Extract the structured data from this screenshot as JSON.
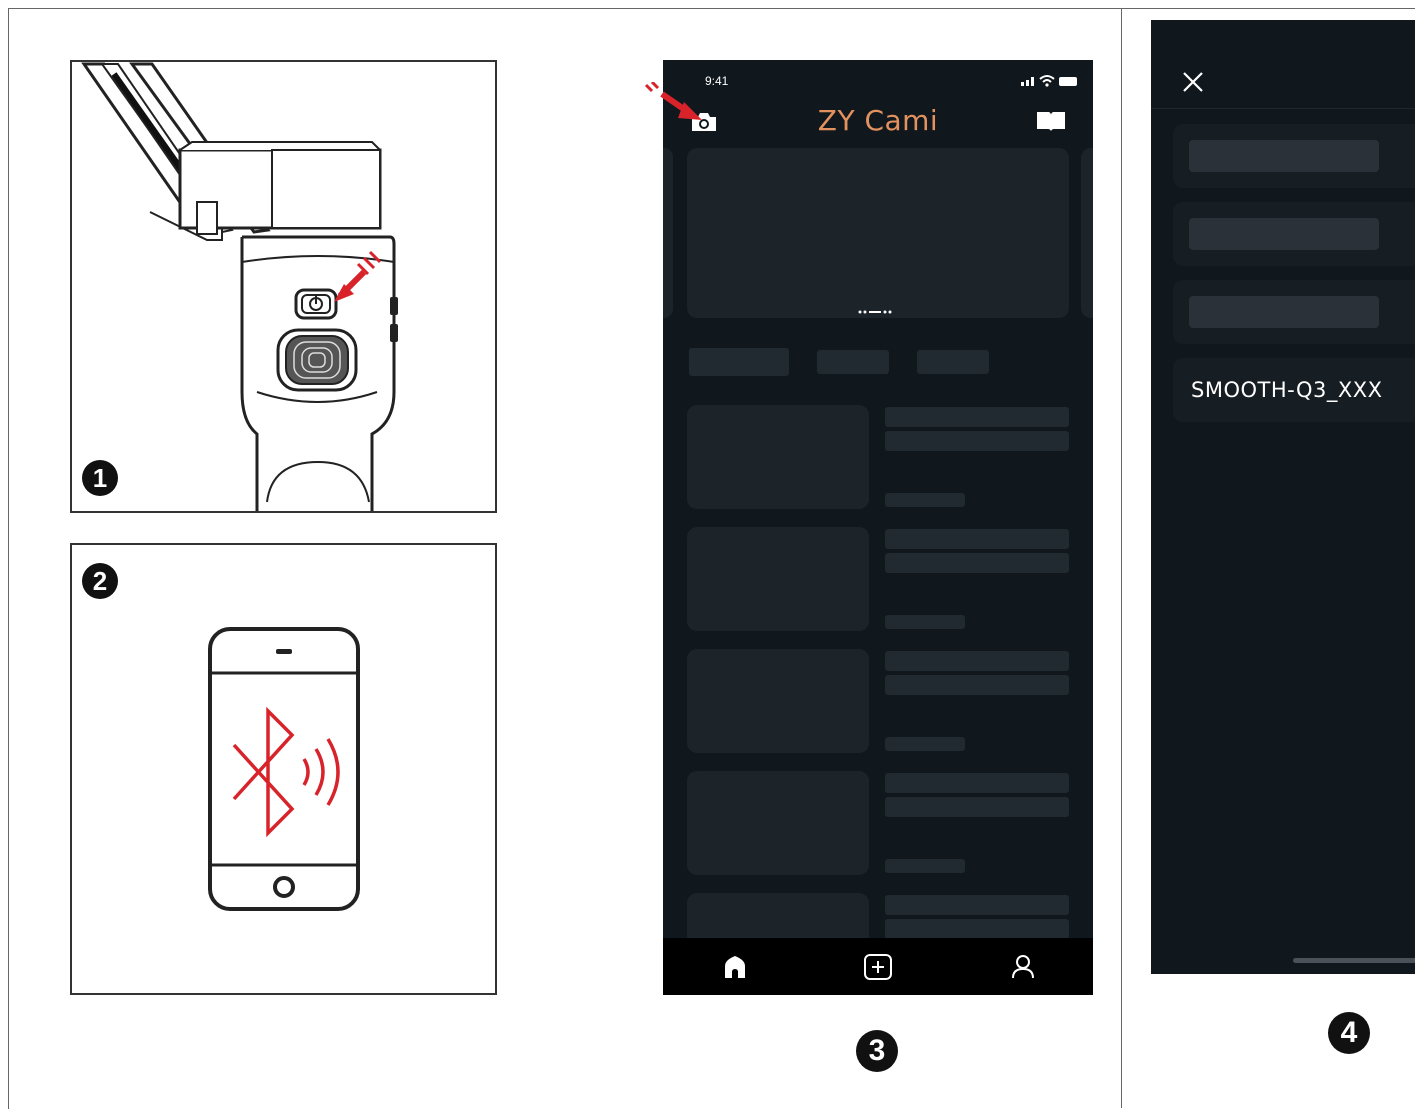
{
  "steps": {
    "step1": "1",
    "step2": "2",
    "step3": "3",
    "step4": "4"
  },
  "app_screen": {
    "status_time": "9:41",
    "title": "ZY Cami",
    "colors": {
      "title": "#e3925f",
      "background": "#10171d",
      "accent_arrow": "#d8232a"
    },
    "icons": [
      "camera-icon",
      "book-icon",
      "home-icon",
      "add-icon",
      "user-icon"
    ]
  },
  "device_list": {
    "icons": [
      "close-icon"
    ],
    "device_name": "SMOOTH-Q3_XXX"
  }
}
